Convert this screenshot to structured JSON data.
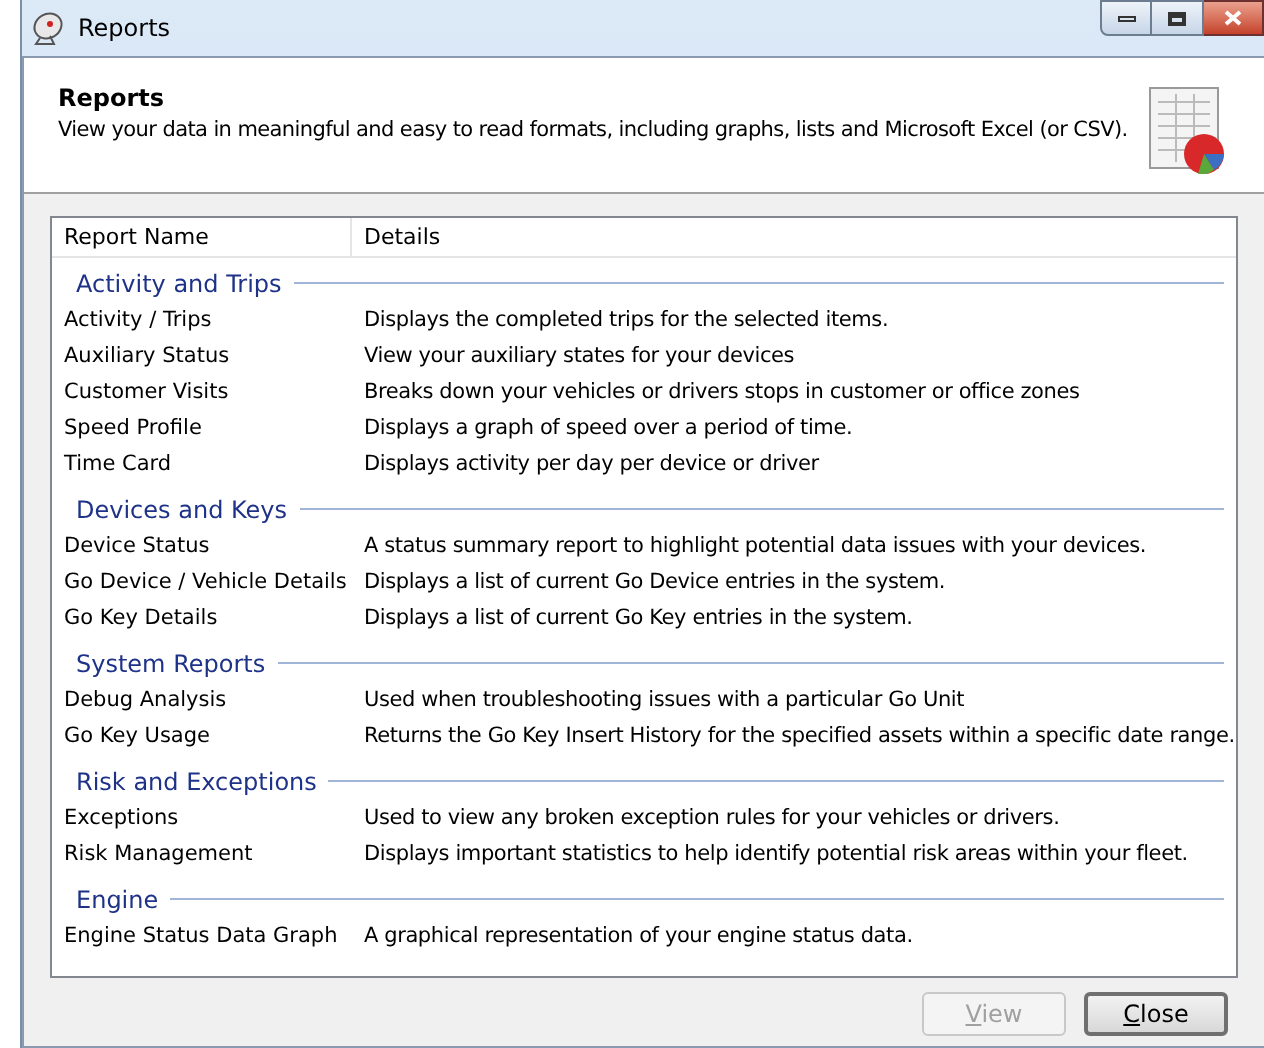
{
  "window": {
    "title": "Reports"
  },
  "header": {
    "title": "Reports",
    "description": "View your data in meaningful and easy to read formats, including graphs, lists and Microsoft Excel (or CSV)."
  },
  "table": {
    "columns": [
      "Report Name",
      "Details"
    ],
    "groups": [
      {
        "name": "Activity and Trips",
        "rows": [
          {
            "name": "Activity / Trips",
            "details": "Displays the completed trips for the selected items."
          },
          {
            "name": "Auxiliary Status",
            "details": "View your auxiliary states for your devices"
          },
          {
            "name": "Customer Visits",
            "details": "Breaks down your vehicles or drivers stops in customer or office zones"
          },
          {
            "name": "Speed Profile",
            "details": "Displays a graph of speed over a period of time."
          },
          {
            "name": "Time Card",
            "details": "Displays activity per day per device or driver"
          }
        ]
      },
      {
        "name": "Devices and Keys",
        "rows": [
          {
            "name": "Device Status",
            "details": "A status summary report to highlight potential data issues with your devices."
          },
          {
            "name": "Go Device / Vehicle Details",
            "details": "Displays a list of current Go Device entries in the system."
          },
          {
            "name": "Go Key Details",
            "details": "Displays a list of current Go Key entries in the system."
          }
        ]
      },
      {
        "name": "System Reports",
        "rows": [
          {
            "name": "Debug Analysis",
            "details": "Used when troubleshooting issues with a particular Go Unit"
          },
          {
            "name": "Go Key Usage",
            "details": "Returns the Go Key Insert History for the specified assets within a specific date range."
          }
        ]
      },
      {
        "name": "Risk and Exceptions",
        "rows": [
          {
            "name": "Exceptions",
            "details": "Used to view any broken exception rules for your vehicles or drivers."
          },
          {
            "name": "Risk Management",
            "details": "Displays important statistics to help identify potential risk areas within your fleet."
          }
        ]
      },
      {
        "name": "Engine",
        "rows": [
          {
            "name": "Engine Status Data Graph",
            "details": "A graphical representation of your engine status data."
          }
        ]
      }
    ]
  },
  "buttons": [
    {
      "label": "View",
      "disabled": true,
      "default": false
    },
    {
      "label": "Close",
      "disabled": false,
      "default": true
    }
  ]
}
